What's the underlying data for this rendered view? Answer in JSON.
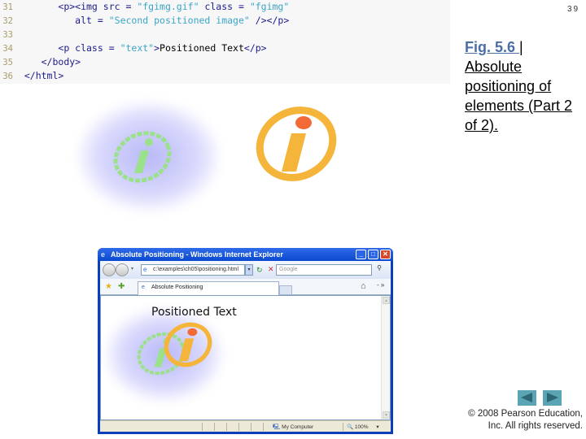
{
  "slide": {
    "number": "39",
    "caption_fig": "Fig. 5.6 ",
    "caption_sep": "|",
    "caption_rest": "Absolute positioning of elements (Part 2 of 2).",
    "copyright_line1": "© 2008 Pearson Education,",
    "copyright_line2": "Inc.  All rights reserved.",
    "prev_label": "previous-slide",
    "next_label": "next-slide"
  },
  "code": {
    "lines": [
      {
        "num": "31",
        "indent": "      ",
        "parts": [
          {
            "t": "<p><img src = ",
            "c": "tag"
          },
          {
            "t": "\"fgimg.gif\"",
            "c": "str"
          },
          {
            "t": " class = ",
            "c": "tag"
          },
          {
            "t": "\"fgimg\"",
            "c": "str"
          }
        ]
      },
      {
        "num": "32",
        "indent": "         ",
        "parts": [
          {
            "t": "alt = ",
            "c": "tag"
          },
          {
            "t": "\"Second positioned image\"",
            "c": "str"
          },
          {
            "t": " /></p>",
            "c": "tag"
          }
        ]
      },
      {
        "num": "33",
        "indent": "",
        "parts": []
      },
      {
        "num": "34",
        "indent": "      ",
        "parts": [
          {
            "t": "<p class = ",
            "c": "tag"
          },
          {
            "t": "\"text\"",
            "c": "str"
          },
          {
            "t": ">",
            "c": "tag"
          },
          {
            "t": "Positioned Text",
            "c": "plain"
          },
          {
            "t": "</p>",
            "c": "tag"
          }
        ]
      },
      {
        "num": "35",
        "indent": "   ",
        "parts": [
          {
            "t": "</body>",
            "c": "tag"
          }
        ]
      },
      {
        "num": "36",
        "indent": "",
        "parts": [
          {
            "t": "</html>",
            "c": "tag"
          }
        ]
      }
    ]
  },
  "browser": {
    "title": "Absolute Positioning - Windows Internet Explorer",
    "address": "c:\\examples\\ch05\\positioning.html",
    "search_placeholder": "Google",
    "tab_label": "Absolute Positioning",
    "page_text": "Positioned Text",
    "status_zone": "My Computer",
    "zoom_level": "100%",
    "min_label": "_",
    "max_label": "□",
    "close_label": "✕"
  },
  "colors": {
    "caption_link": "#4a6fa5",
    "ie_frame": "#0a3fb9",
    "orange_ring": "#f5b43a",
    "orange_dot": "#f26a36",
    "green_ring": "#9be08a",
    "nav_button": "#5aa4b4"
  }
}
